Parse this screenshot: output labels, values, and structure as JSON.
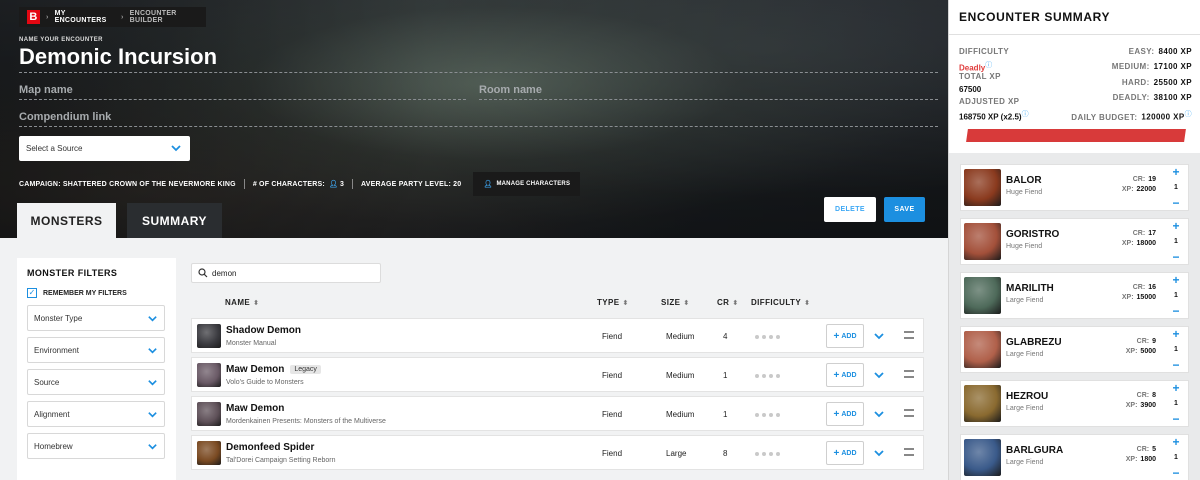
{
  "breadcrumb": {
    "logo": "B",
    "items": [
      "MY ENCOUNTERS",
      "ENCOUNTER BUILDER"
    ]
  },
  "encounter": {
    "name_label": "NAME YOUR ENCOUNTER",
    "name": "Demonic Incursion",
    "map_placeholder": "Map name",
    "room_placeholder": "Room name",
    "compendium_placeholder": "Compendium link",
    "source_select": "Select a Source"
  },
  "campaign": {
    "campaign_text": "CAMPAIGN: SHATTERED CROWN OF THE NEVERMORE KING",
    "characters_label": "# OF CHARACTERS:",
    "characters_count": "3",
    "party_level_text": "AVERAGE PARTY LEVEL: 20",
    "manage_label": "MANAGE CHARACTERS"
  },
  "tabs": {
    "monsters": "MONSTERS",
    "summary": "SUMMARY"
  },
  "actions": {
    "delete": "DELETE",
    "save": "SAVE"
  },
  "filters": {
    "title": "MONSTER FILTERS",
    "remember": "REMEMBER MY FILTERS",
    "selects": [
      "Monster Type",
      "Environment",
      "Source",
      "Alignment",
      "Homebrew"
    ]
  },
  "search": {
    "value": "demon"
  },
  "columns": {
    "name": "NAME",
    "type": "TYPE",
    "size": "SIZE",
    "cr": "CR",
    "difficulty": "DIFFICULTY"
  },
  "add_label": "ADD",
  "monsters": [
    {
      "name": "Shadow Demon",
      "source": "Monster Manual",
      "type": "Fiend",
      "size": "Medium",
      "cr": "4",
      "tag": "",
      "color": "#3b3b40"
    },
    {
      "name": "Maw Demon",
      "source": "Volo's Guide to Monsters",
      "type": "Fiend",
      "size": "Medium",
      "cr": "1",
      "tag": "Legacy",
      "color": "#6a5a66"
    },
    {
      "name": "Maw Demon",
      "source": "Mordenkainen Presents: Monsters of the Multiverse",
      "type": "Fiend",
      "size": "Medium",
      "cr": "1",
      "tag": "",
      "color": "#5e5058"
    },
    {
      "name": "Demonfeed Spider",
      "source": "Tal'Dorei Campaign Setting Reborn",
      "type": "Fiend",
      "size": "Large",
      "cr": "8",
      "tag": "",
      "color": "#7a4a22"
    }
  ],
  "summary": {
    "title": "ENCOUNTER SUMMARY",
    "difficulty_label": "DIFFICULTY",
    "difficulty_value": "Deadly",
    "total_xp_label": "TOTAL XP",
    "total_xp_value": "67500",
    "adjusted_xp_label": "ADJUSTED XP",
    "adjusted_xp_value": "168750 XP (x2.5)",
    "thresholds": [
      {
        "label": "EASY:",
        "value": "8400 XP"
      },
      {
        "label": "MEDIUM:",
        "value": "17100 XP"
      },
      {
        "label": "HARD:",
        "value": "25500 XP"
      },
      {
        "label": "DEADLY:",
        "value": "38100 XP"
      },
      {
        "label": "DAILY BUDGET:",
        "value": "120000 XP"
      }
    ],
    "difficulty_color": "#e03c3c",
    "creatures": [
      {
        "name": "BALOR",
        "sub": "Huge Fiend",
        "cr": "19",
        "xp": "22000",
        "qty": "1",
        "color": "#8a3a1e"
      },
      {
        "name": "GORISTRO",
        "sub": "Huge Fiend",
        "cr": "17",
        "xp": "18000",
        "qty": "1",
        "color": "#a3503a"
      },
      {
        "name": "MARILITH",
        "sub": "Large Fiend",
        "cr": "16",
        "xp": "15000",
        "qty": "1",
        "color": "#4e6a5a"
      },
      {
        "name": "GLABREZU",
        "sub": "Large Fiend",
        "cr": "9",
        "xp": "5000",
        "qty": "1",
        "color": "#b0604a"
      },
      {
        "name": "HEZROU",
        "sub": "Large Fiend",
        "cr": "8",
        "xp": "3900",
        "qty": "1",
        "color": "#8a6a30"
      },
      {
        "name": "BARLGURA",
        "sub": "Large Fiend",
        "cr": "5",
        "xp": "1800",
        "qty": "1",
        "color": "#3a5a8a"
      }
    ],
    "cr_label": "CR:",
    "xp_label": "XP:"
  }
}
